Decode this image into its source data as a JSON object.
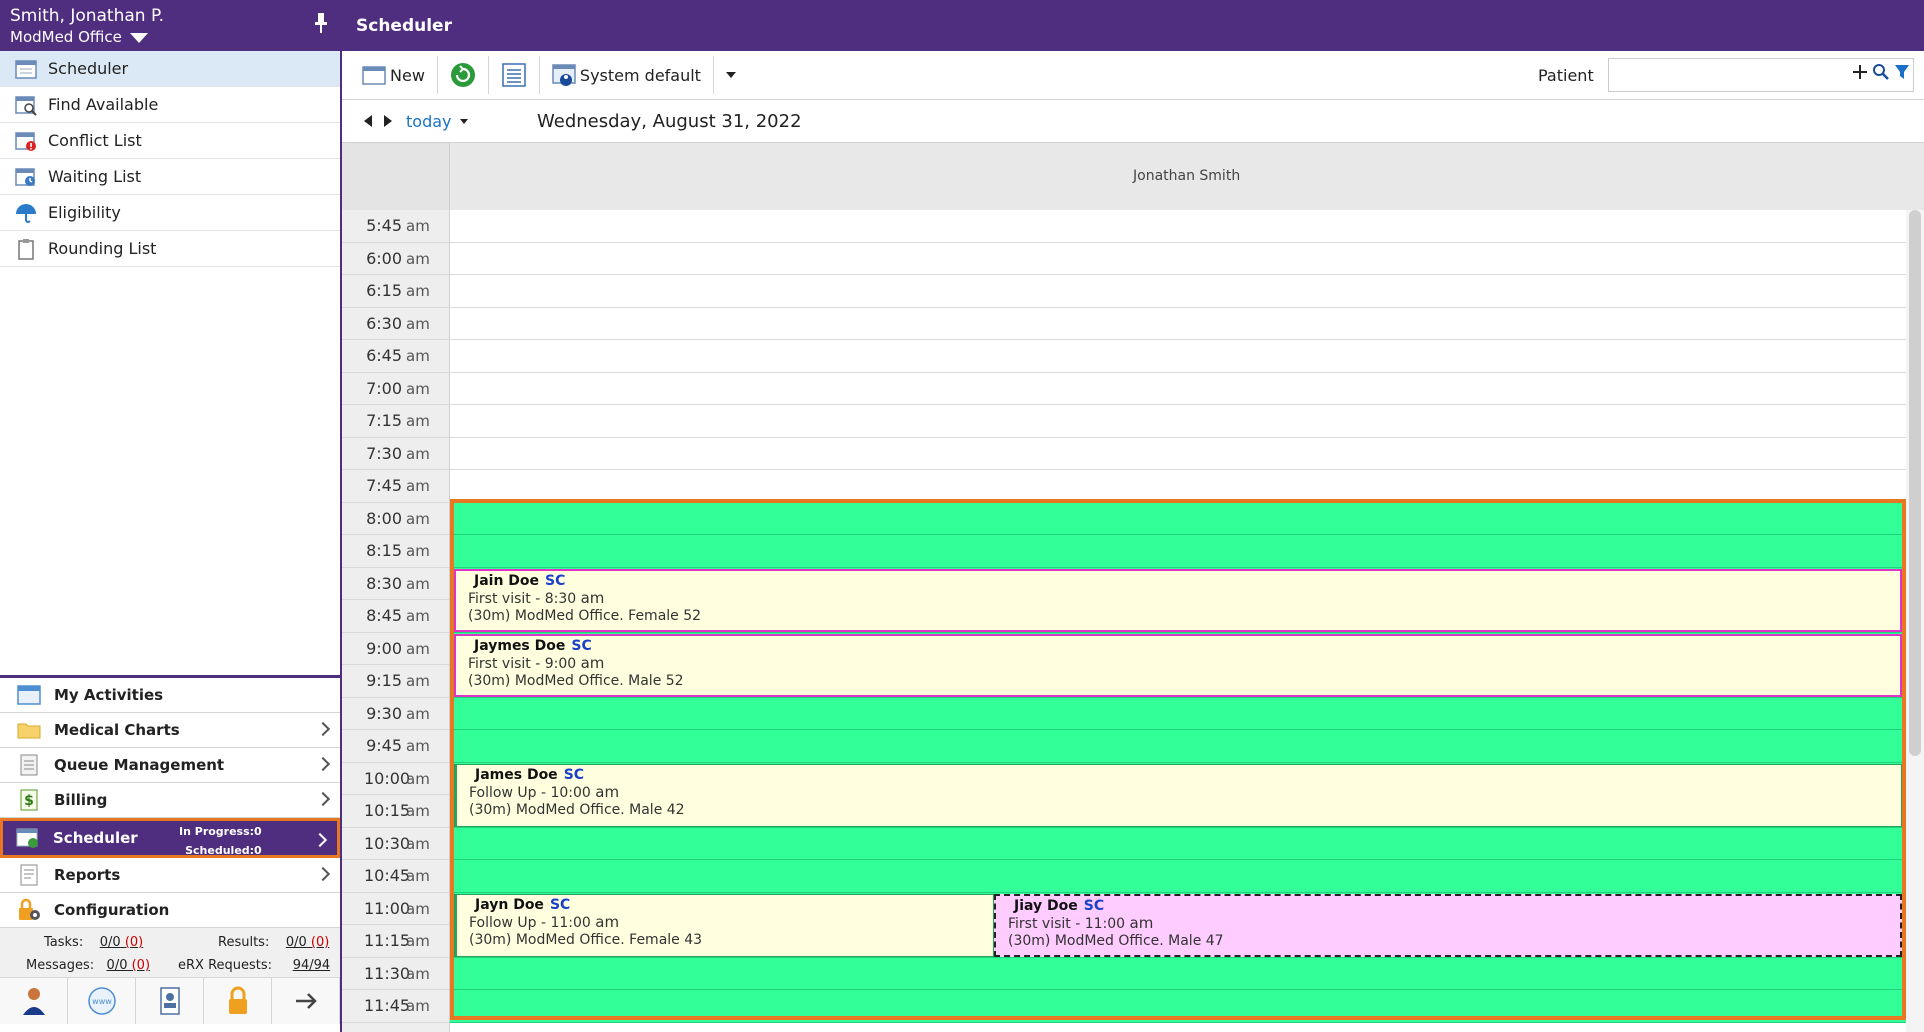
{
  "user": {
    "name": "Smith, Jonathan P.",
    "office": "ModMed Office"
  },
  "nav": {
    "items": [
      {
        "label": "Scheduler",
        "icon": "calendar-icon",
        "active": true
      },
      {
        "label": "Find Available",
        "icon": "find-available-icon"
      },
      {
        "label": "Conflict List",
        "icon": "conflict-list-icon"
      },
      {
        "label": "Waiting List",
        "icon": "waiting-list-icon"
      },
      {
        "label": "Eligibility",
        "icon": "eligibility-icon"
      },
      {
        "label": "Rounding List",
        "icon": "clipboard-icon"
      }
    ]
  },
  "modules": {
    "my_activities": "My Activities",
    "medical_charts": "Medical Charts",
    "queue_management": "Queue Management",
    "billing": "Billing",
    "scheduler": "Scheduler",
    "scheduler_in_progress": "In Progress:0",
    "scheduler_scheduled": "Scheduled:0",
    "reports": "Reports",
    "configuration": "Configuration"
  },
  "stats": {
    "tasks_label": "Tasks:",
    "tasks_value": "0/0",
    "tasks_red": "(0)",
    "results_label": "Results:",
    "results_value": "0/0",
    "results_red": "(0)",
    "messages_label": "Messages:",
    "messages_value": "0/0",
    "messages_red": "(0)",
    "erx_label": "eRX Requests:",
    "erx_value": "94/94"
  },
  "main": {
    "title": "Scheduler",
    "toolbar": {
      "new_label": "New",
      "view_label": "System default",
      "patient_label": "Patient",
      "patient_value": ""
    },
    "date_bar": {
      "today_label": "today",
      "date": "Wednesday, August 31, 2022"
    },
    "provider": "Jonathan Smith"
  },
  "times": [
    {
      "hm": "5:45",
      "ampm": "am"
    },
    {
      "hm": "6:00",
      "ampm": "am"
    },
    {
      "hm": "6:15",
      "ampm": "am"
    },
    {
      "hm": "6:30",
      "ampm": "am"
    },
    {
      "hm": "6:45",
      "ampm": "am"
    },
    {
      "hm": "7:00",
      "ampm": "am"
    },
    {
      "hm": "7:15",
      "ampm": "am"
    },
    {
      "hm": "7:30",
      "ampm": "am"
    },
    {
      "hm": "7:45",
      "ampm": "am"
    },
    {
      "hm": "8:00",
      "ampm": "am"
    },
    {
      "hm": "8:15",
      "ampm": "am"
    },
    {
      "hm": "8:30",
      "ampm": "am"
    },
    {
      "hm": "8:45",
      "ampm": "am"
    },
    {
      "hm": "9:00",
      "ampm": "am"
    },
    {
      "hm": "9:15",
      "ampm": "am"
    },
    {
      "hm": "9:30",
      "ampm": "am"
    },
    {
      "hm": "9:45",
      "ampm": "am"
    },
    {
      "hm": "10:00",
      "ampm": "am"
    },
    {
      "hm": "10:15",
      "ampm": "am"
    },
    {
      "hm": "10:30",
      "ampm": "am"
    },
    {
      "hm": "10:45",
      "ampm": "am"
    },
    {
      "hm": "11:00",
      "ampm": "am"
    },
    {
      "hm": "11:15",
      "ampm": "am"
    },
    {
      "hm": "11:30",
      "ampm": "am"
    },
    {
      "hm": "11:45",
      "ampm": "am"
    }
  ],
  "appointments": [
    {
      "name": "Jain Doe",
      "tag": "SC",
      "visit": "First visit - 8:30",
      "ampm": "am",
      "detail": "(30m) ModMed Office. Female 52"
    },
    {
      "name": "Jaymes Doe",
      "tag": "SC",
      "visit": "First visit - 9:00",
      "ampm": "am",
      "detail": "(30m) ModMed Office. Male 52"
    },
    {
      "name": "James Doe",
      "tag": "SC",
      "visit": "Follow Up - 10:00",
      "ampm": "am",
      "detail": "(30m) ModMed Office. Male 42"
    },
    {
      "name": "Jayn Doe",
      "tag": "SC",
      "visit": "Follow Up - 11:00",
      "ampm": "am",
      "detail": "(30m) ModMed Office. Female 43"
    },
    {
      "name": "Jiay Doe",
      "tag": "SC",
      "visit": "First visit - 11:00",
      "ampm": "am",
      "detail": "(30m) ModMed Office. Male 47"
    }
  ],
  "colors": {
    "brand": "#4f2d7f",
    "available": "#33ff99",
    "highlight": "#e87722",
    "appointment": "#ffffe0",
    "pending": "#ffccff"
  }
}
